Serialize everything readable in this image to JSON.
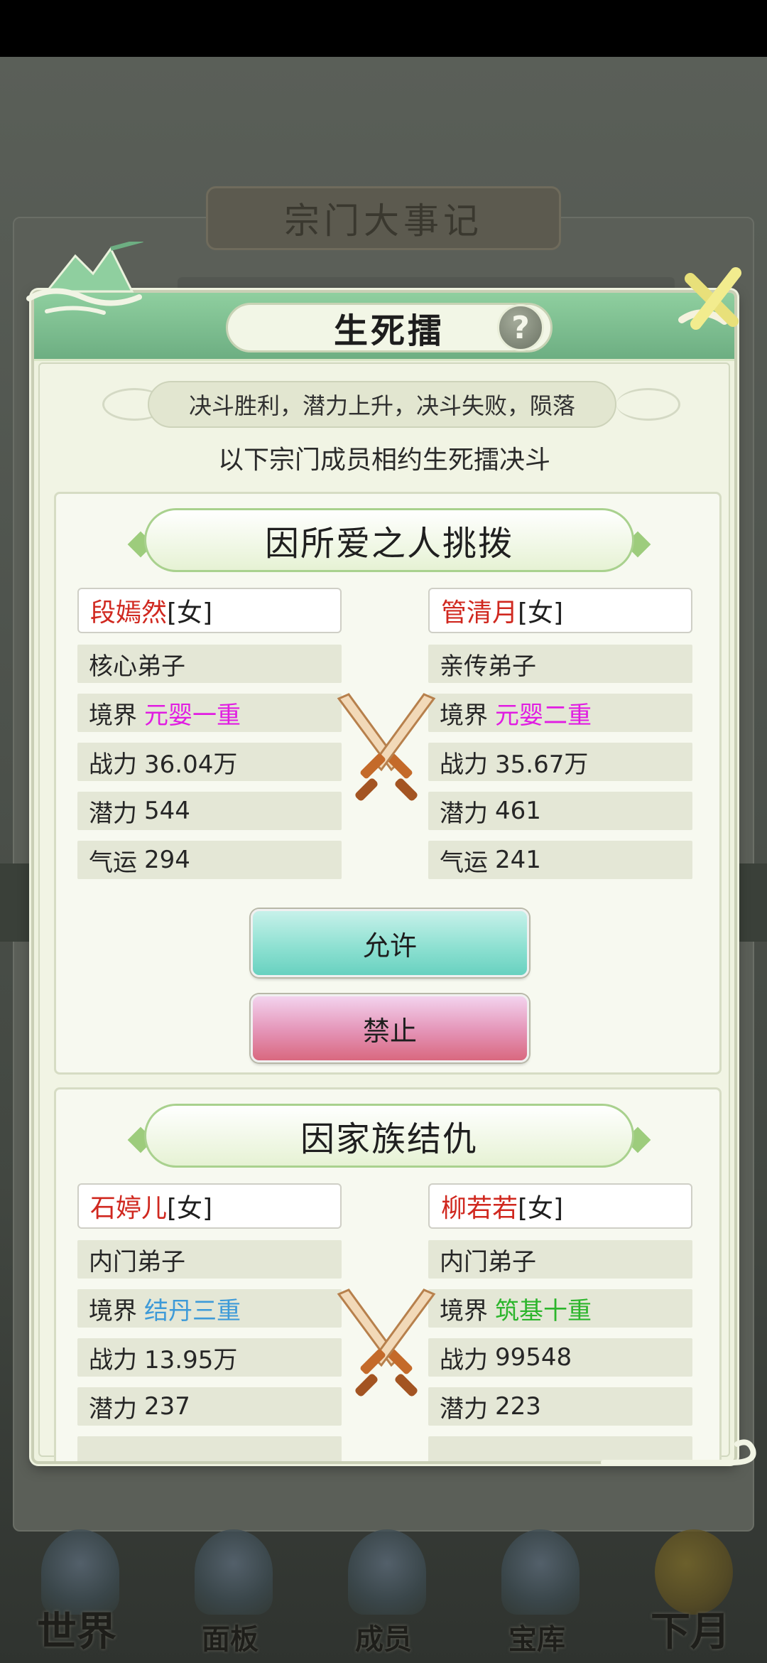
{
  "background": {
    "panel_title": "宗门大事记"
  },
  "modal": {
    "title": "生死擂",
    "help_label": "?",
    "subtitle": "决斗胜利，潜力上升，决斗失败，陨落",
    "intro": "以下宗门成员相约生死擂决斗"
  },
  "duels": [
    {
      "reason": "因所爱之人挑拨",
      "left": {
        "name": "段嫣然",
        "gender": "[女]",
        "rank": "核心弟子",
        "realm_label": "境界",
        "realm": "元婴一重",
        "power_label": "战力",
        "power": "36.04万",
        "potential_label": "潜力",
        "potential": "544",
        "luck_label": "气运",
        "luck": "294"
      },
      "right": {
        "name": "管清月",
        "gender": "[女]",
        "rank": "亲传弟子",
        "realm_label": "境界",
        "realm": "元婴二重",
        "power_label": "战力",
        "power": "35.67万",
        "potential_label": "潜力",
        "potential": "461",
        "luck_label": "气运",
        "luck": "241"
      },
      "allow_label": "允许",
      "forbid_label": "禁止"
    },
    {
      "reason": "因家族结仇",
      "left": {
        "name": "石婷儿",
        "gender": "[女]",
        "rank": "内门弟子",
        "realm_label": "境界",
        "realm": "结丹三重",
        "power_label": "战力",
        "power": "13.95万",
        "potential_label": "潜力",
        "potential": "237"
      },
      "right": {
        "name": "柳若若",
        "gender": "[女]",
        "rank": "内门弟子",
        "realm_label": "境界",
        "realm": "筑基十重",
        "power_label": "战力",
        "power": "99548",
        "potential_label": "潜力",
        "potential": "223"
      }
    }
  ],
  "bottom_nav": [
    {
      "label": "世界",
      "icon": "world-pagoda-icon"
    },
    {
      "label": "面板",
      "icon": "panel-temple-icon"
    },
    {
      "label": "成员",
      "icon": "members-portrait-icon"
    },
    {
      "label": "宝库",
      "icon": "treasury-building-icon"
    },
    {
      "label": "下月",
      "icon": "next-month-moon-icon"
    }
  ],
  "colors": {
    "header_green": "#6dae82",
    "name_red": "#d0281f",
    "realm_magenta": "#e11ce2",
    "realm_blue": "#3d9ad8",
    "realm_green": "#2cb52c",
    "allow_teal": "#68d1c0",
    "forbid_pink": "#d9687f"
  }
}
